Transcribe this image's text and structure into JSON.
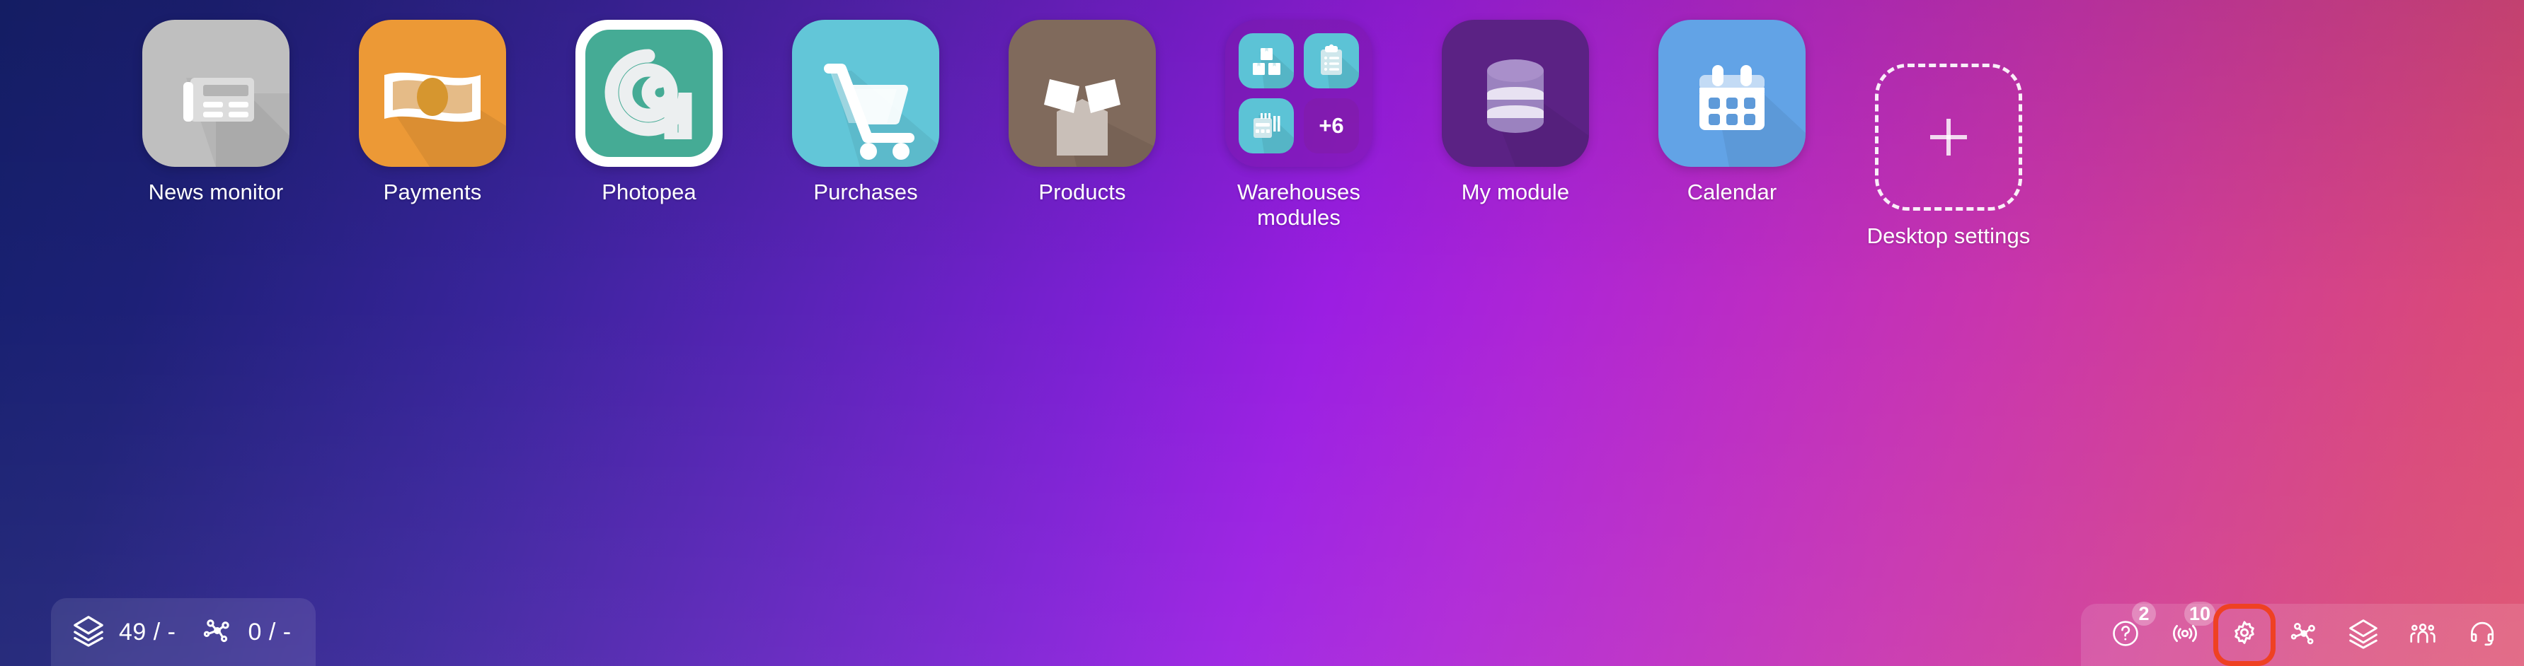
{
  "desktop": {
    "apps": [
      {
        "label": "News monitor",
        "icon": "newspaper-icon",
        "tile_class": "t-news",
        "color": "#bfbfbf"
      },
      {
        "label": "Payments",
        "icon": "banknote-icon",
        "tile_class": "t-pay",
        "color": "#ec9936"
      },
      {
        "label": "Photopea",
        "icon": "photopea-spiral-icon",
        "tile_class": "t-photopea",
        "color": "#45ab95"
      },
      {
        "label": "Purchases",
        "icon": "shopping-cart-icon",
        "tile_class": "t-purch",
        "color": "#62c6d8"
      },
      {
        "label": "Products",
        "icon": "open-box-icon",
        "tile_class": "t-prod",
        "color": "#806a5c"
      },
      {
        "label": "Warehouses modules",
        "icon": "folder-icon",
        "tile_class": "t-folder",
        "color": "#7819a0"
      },
      {
        "label": "My module",
        "icon": "database-icon",
        "tile_class": "t-mymod",
        "color": "#5b2284"
      },
      {
        "label": "Calendar",
        "icon": "calendar-icon",
        "tile_class": "t-cal",
        "color": "#62a3e6"
      }
    ],
    "folder": {
      "name": "Warehouses modules",
      "overflow_label": "+6",
      "mini_icons": [
        "stacked-boxes-icon",
        "clipboard-list-icon",
        "barcode-scanner-icon"
      ]
    },
    "add_tile": {
      "label": "Desktop settings",
      "icon": "plus-icon"
    }
  },
  "status_bar": {
    "items": [
      {
        "icon": "layers-icon",
        "value": "49 / -"
      },
      {
        "icon": "network-nodes-icon",
        "value": "0 / -"
      }
    ]
  },
  "toolbar": {
    "buttons": [
      {
        "name": "help",
        "icon": "help-circle-icon",
        "badge": "2",
        "highlighted": false
      },
      {
        "name": "broadcast",
        "icon": "broadcast-icon",
        "badge": "10",
        "highlighted": false
      },
      {
        "name": "settings",
        "icon": "gear-icon",
        "badge": "",
        "highlighted": true
      },
      {
        "name": "share",
        "icon": "network-nodes-icon",
        "badge": "",
        "highlighted": false
      },
      {
        "name": "layers",
        "icon": "layers-icon",
        "badge": "",
        "highlighted": false
      },
      {
        "name": "users",
        "icon": "users-group-icon",
        "badge": "",
        "highlighted": false
      },
      {
        "name": "support",
        "icon": "headset-icon",
        "badge": "",
        "highlighted": false
      }
    ],
    "highlight_color": "#ef4123"
  }
}
